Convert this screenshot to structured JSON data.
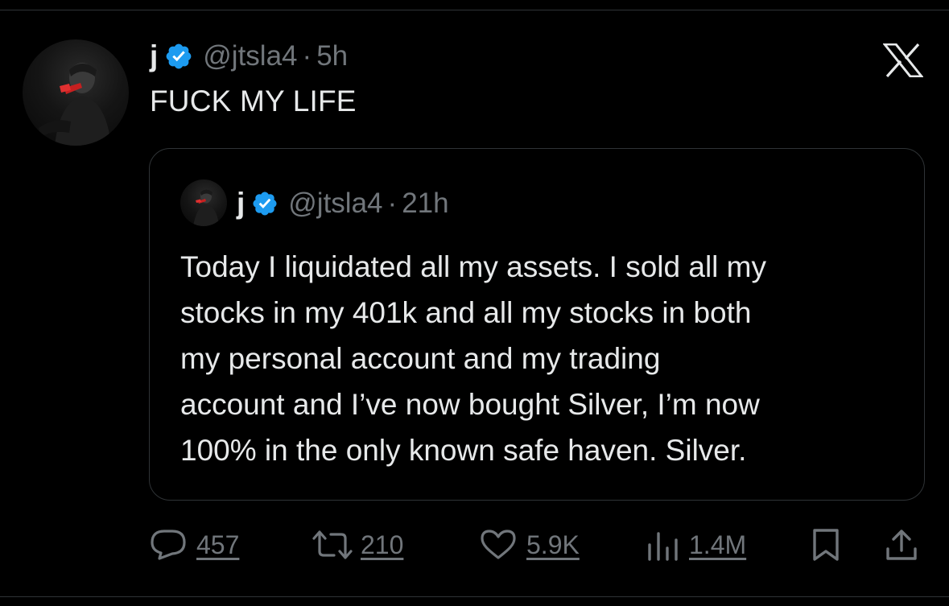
{
  "tweet": {
    "author_name": "j",
    "handle": "@jtsla4",
    "separator": "·",
    "time": "5h",
    "text": "FUCK MY LIFE",
    "verified_icon": "verified-badge-icon",
    "brand_icon": "x-logo-icon"
  },
  "quote": {
    "author_name": "j",
    "handle": "@jtsla4",
    "separator": "·",
    "time": "21h",
    "lines": [
      "Today I liquidated all my assets. I sold all my",
      "stocks in my 401k and all my stocks in both",
      "my personal account and my trading",
      "account and I’ve now bought Silver, I’m now",
      "100% in the only known safe haven. Silver."
    ]
  },
  "actions": {
    "replies": "457",
    "reposts": "210",
    "likes": "5.9K",
    "views": "1.4M",
    "icons": [
      "reply-icon",
      "repost-icon",
      "like-icon",
      "views-icon",
      "bookmark-icon",
      "share-icon"
    ]
  },
  "colors": {
    "background": "#000000",
    "text": "#e7e9ea",
    "muted": "#71767b",
    "verified": "#1d9bf0",
    "border": "#2f3336"
  }
}
